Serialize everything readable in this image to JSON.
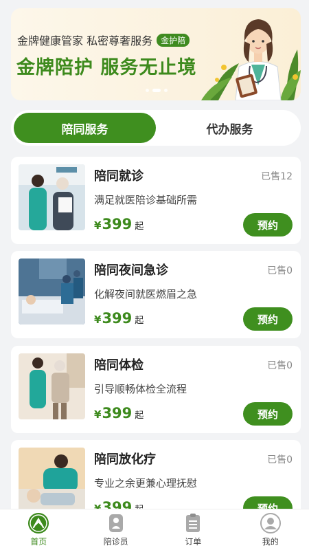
{
  "banner": {
    "subtitle": "金牌健康管家 私密尊奢服务",
    "badge": "金护陪",
    "title": "金牌陪护 服务无止境"
  },
  "tabs": [
    {
      "label": "陪同服务",
      "active": true
    },
    {
      "label": "代办服务",
      "active": false
    }
  ],
  "services": [
    {
      "title": "陪同就诊",
      "sold": "已售12",
      "desc": "满足就医陪诊基础所需",
      "currency": "¥",
      "price": "399",
      "suffix": "起",
      "button": "预约",
      "image": "nurse-with-elderly-in-hospital"
    },
    {
      "title": "陪同夜间急诊",
      "sold": "已售0",
      "desc": "化解夜间就医燃眉之急",
      "currency": "¥",
      "price": "399",
      "suffix": "起",
      "button": "预约",
      "image": "emergency-ward-at-night"
    },
    {
      "title": "陪同体检",
      "sold": "已售0",
      "desc": "引导顺畅体检全流程",
      "currency": "¥",
      "price": "399",
      "suffix": "起",
      "button": "预约",
      "image": "nurse-helping-elderly-walk"
    },
    {
      "title": "陪同放化疗",
      "sold": "已售0",
      "desc": "专业之余更兼心理抚慰",
      "currency": "¥",
      "price": "399",
      "suffix": "起",
      "button": "预约",
      "image": "nurse-caring-patient"
    }
  ],
  "nav": [
    {
      "label": "首页",
      "icon": "home-icon",
      "active": true
    },
    {
      "label": "陪诊员",
      "icon": "companion-icon",
      "active": false
    },
    {
      "label": "订单",
      "icon": "order-icon",
      "active": false
    },
    {
      "label": "我的",
      "icon": "profile-icon",
      "active": false
    }
  ],
  "colors": {
    "accent": "#3f8f1f",
    "price": "#3d8a1d",
    "background": "#f2f3f5"
  }
}
